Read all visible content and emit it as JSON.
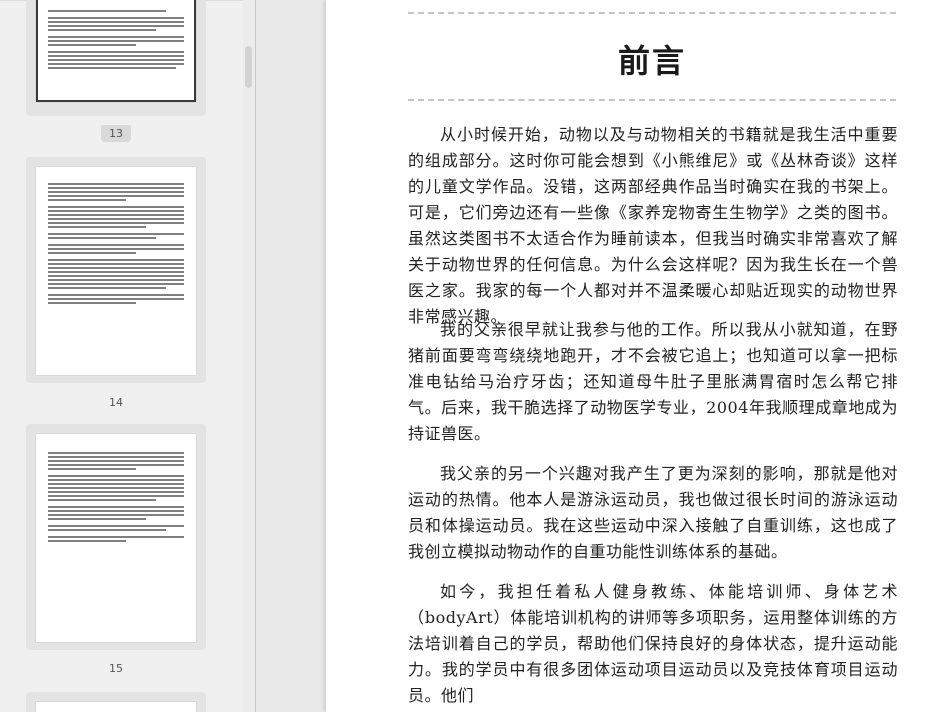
{
  "sidebar": {
    "thumbnails": [
      {
        "page_label": "13",
        "selected": true
      },
      {
        "page_label": "14",
        "selected": false
      },
      {
        "page_label": "15",
        "selected": false
      }
    ]
  },
  "document": {
    "title": "前言",
    "paragraphs": [
      "从小时候开始，动物以及与动物相关的书籍就是我生活中重要的组成部分。这时你可能会想到《小熊维尼》或《丛林奇谈》这样的儿童文学作品。没错，这两部经典作品当时确实在我的书架上。可是，它们旁边还有一些像《家养宠物寄生生物学》之类的图书。虽然这类图书不太适合作为睡前读本，但我当时确实非常喜欢了解关于动物世界的任何信息。为什么会这样呢？因为我生长在一个兽医之家。我家的每一个人都对并不温柔暖心却贴近现实的动物世界非常感兴趣。",
      "我的父亲很早就让我参与他的工作。所以我从小就知道，在野猪前面要弯弯绕绕地跑开，才不会被它追上；也知道可以拿一把标准电钻给马治疗牙齿；还知道母牛肚子里胀满胃宿时怎么帮它排气。后来，我干脆选择了动物医学专业，2004年我顺理成章地成为持证兽医。",
      "我父亲的另一个兴趣对我产生了更为深刻的影响，那就是他对运动的热情。他本人是游泳运动员，我也做过很长时间的游泳运动员和体操运动员。我在这些运动中深入接触了自重训练，这也成了我创立模拟动物动作的自重功能性训练体系的基础。",
      "如今，我担任着私人健身教练、体能培训师、身体艺术（bodyArt）体能培训机构的讲师等多项职务，运用整体训练的方法培训着自己的学员，帮助他们保持良好的身体状态，提升运动能力。我的学员中有很多团体运动项目运动员以及竞技体育项目运动员。他们"
    ]
  }
}
